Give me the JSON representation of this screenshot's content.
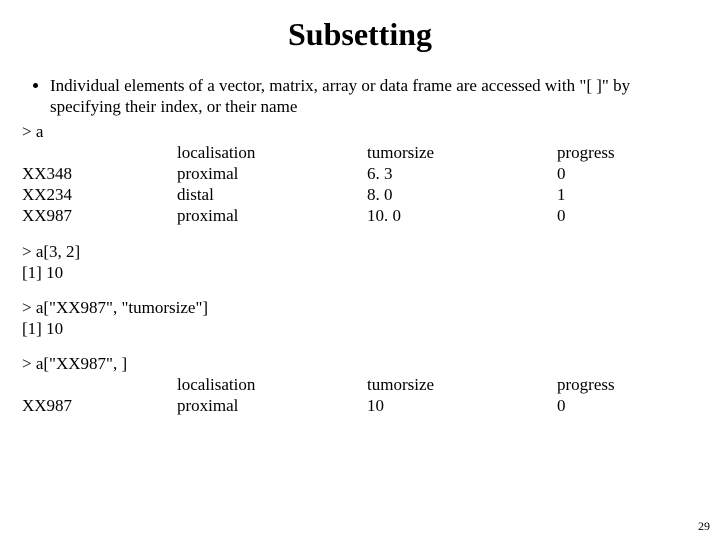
{
  "title": "Subsetting",
  "bullet": "Individual elements of a vector, matrix, array or data frame are accessed with \"[ ]\" by specifying their index, or their name",
  "prompt_a": "> a",
  "table1": {
    "h0": "",
    "h1": "localisation",
    "h2": "tumorsize",
    "h3": "progress",
    "r1c0": "XX348",
    "r1c1": "proximal",
    "r1c2": "6. 3",
    "r1c3": "0",
    "r2c0": "XX234",
    "r2c1": "distal",
    "r2c2": "8. 0",
    "r2c3": "1",
    "r3c0": "XX987",
    "r3c1": "proximal",
    "r3c2": "10. 0",
    "r3c3": "0"
  },
  "ex1_cmd": "> a[3, 2]",
  "ex1_out": "[1] 10",
  "ex2_cmd": "> a[\"XX987\", \"tumorsize\"]",
  "ex2_out": "[1] 10",
  "ex3_cmd": "> a[\"XX987\", ]",
  "table2": {
    "h0": "",
    "h1": "localisation",
    "h2": "tumorsize",
    "h3": "progress",
    "r1c0": "XX987",
    "r1c1": "proximal",
    "r1c2": "10",
    "r1c3": "0"
  },
  "page_number": "29"
}
